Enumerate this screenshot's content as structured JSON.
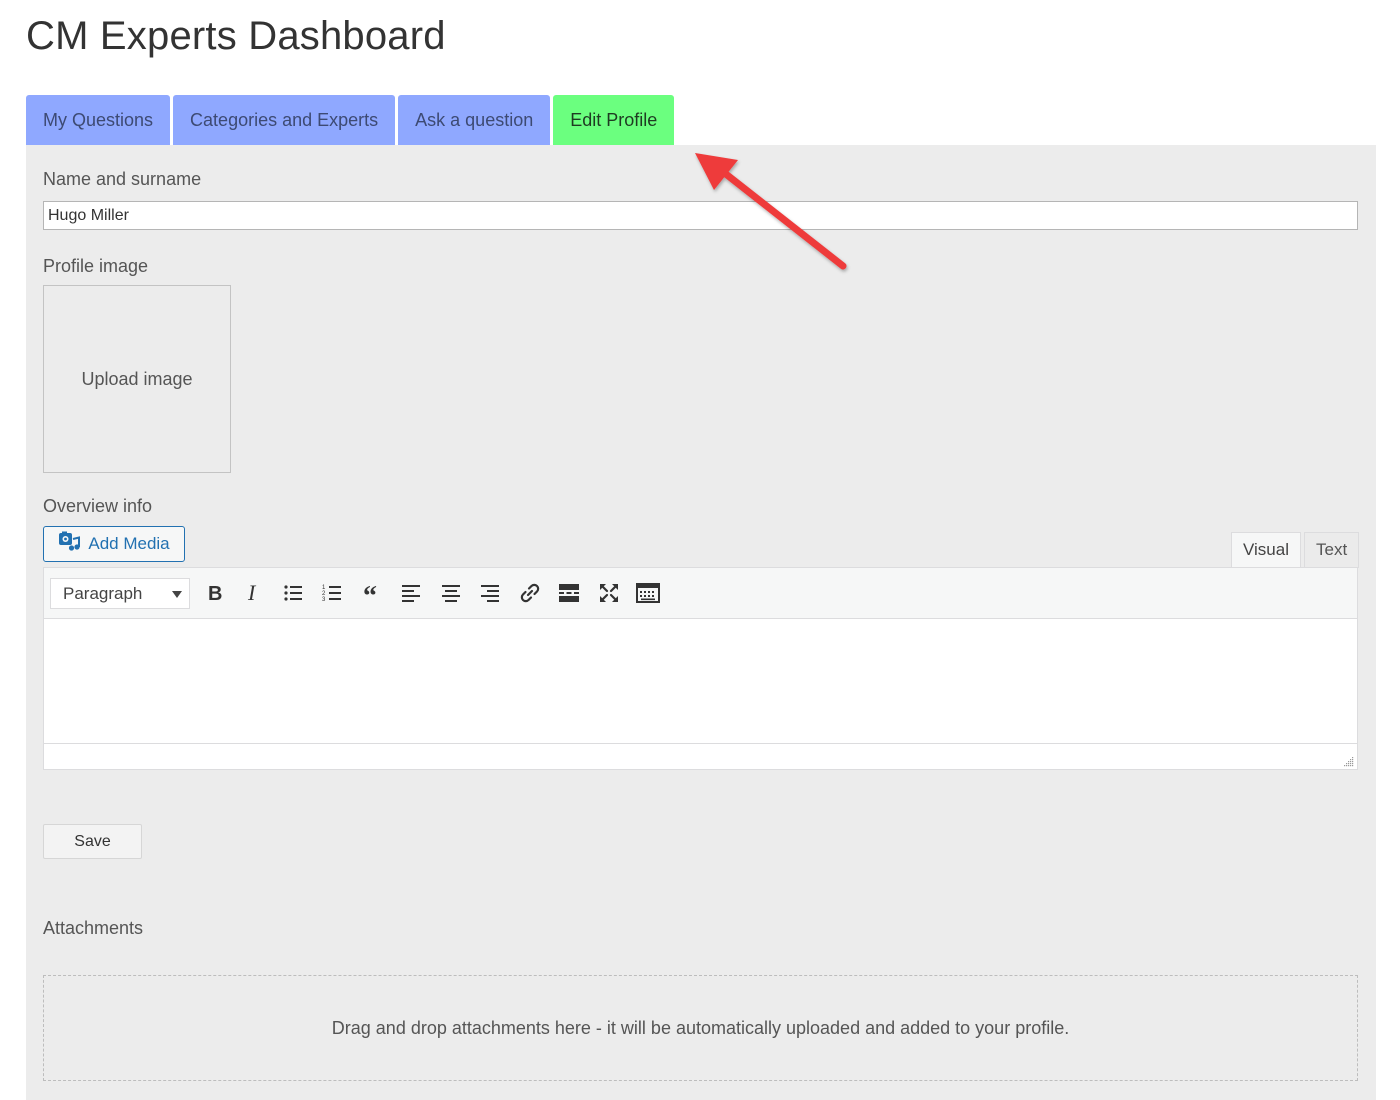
{
  "page": {
    "title": "CM Experts Dashboard"
  },
  "tabs": [
    {
      "label": "My Questions",
      "active": false
    },
    {
      "label": "Categories and Experts",
      "active": false
    },
    {
      "label": "Ask a question",
      "active": false
    },
    {
      "label": "Edit Profile",
      "active": true
    }
  ],
  "colors": {
    "tab_inactive": "#8fa8ff",
    "tab_active": "#6bff7f",
    "panel_bg": "#ececec",
    "annotation_arrow": "#ee3a3a",
    "link_blue": "#2271b1"
  },
  "form": {
    "name": {
      "label": "Name and surname",
      "value": "Hugo Miller"
    },
    "profile_image": {
      "label": "Profile image",
      "upload_label": "Upload image"
    },
    "overview": {
      "label": "Overview info",
      "add_media_label": "Add Media",
      "editor_tabs": {
        "visual": "Visual",
        "text": "Text"
      },
      "format_select": "Paragraph",
      "toolbar_icons": [
        "bold-icon",
        "italic-icon",
        "bulleted-list-icon",
        "numbered-list-icon",
        "blockquote-icon",
        "align-left-icon",
        "align-center-icon",
        "align-right-icon",
        "link-icon",
        "read-more-icon",
        "fullscreen-icon",
        "toolbar-toggle-icon"
      ]
    },
    "save_label": "Save"
  },
  "attachments": {
    "label": "Attachments",
    "dropzone_text": "Drag and drop attachments here - it will be automatically uploaded and added to your profile."
  }
}
